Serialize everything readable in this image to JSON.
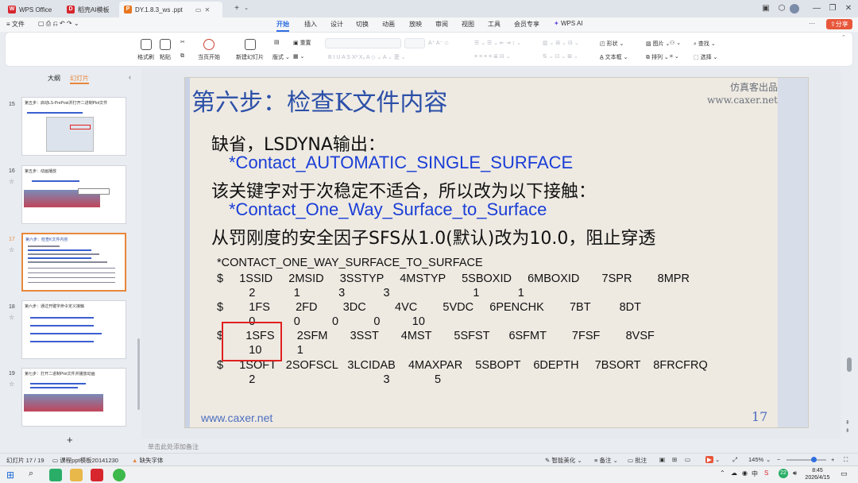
{
  "tabs": [
    {
      "label": "WPS Office",
      "color": "#d7262e"
    },
    {
      "label": "稻壳AI模板",
      "color": "#d7262e"
    },
    {
      "label": "DY.1.8.3_ws .ppt",
      "color": "#e8761f"
    }
  ],
  "menu": {
    "file": "文件",
    "items": [
      "开始",
      "插入",
      "设计",
      "切换",
      "动画",
      "放映",
      "审阅",
      "视图",
      "工具",
      "会员专享"
    ],
    "wps_ai": "WPS AI",
    "share": "分享"
  },
  "ribbon": {
    "format_painter": "格式刷",
    "paste": "粘贴",
    "play_current": "当页开始",
    "new_slide": "新建幻灯片",
    "layout": "版式",
    "reset": "重置",
    "shape": "形状",
    "image": "图片",
    "textbox": "文本框",
    "arrange": "排列",
    "find": "查找",
    "select": "选择"
  },
  "panel": {
    "tab_outline": "大纲",
    "tab_slides": "幻灯片",
    "add": "+"
  },
  "thumbs": [
    {
      "num": "15",
      "title": "第五步：启动LS-PrePost并打开二进制Plot文件"
    },
    {
      "num": "16",
      "title": "第五步：动画播放"
    },
    {
      "num": "17",
      "title": "第六步：检查K文件内容"
    },
    {
      "num": "18",
      "title": "第六步：通过开键字命令定义接触"
    },
    {
      "num": "19",
      "title": "第七步：打开二进制Plot文件并播放动画"
    }
  ],
  "slide": {
    "title": "第六步：检查K文件内容",
    "brand_line1": "仿真客出品",
    "brand_line2": "www.caxer.net",
    "line1": "缺省，LSDYNA输出：",
    "kw1": "*Contact_AUTOMATIC_SINGLE_SURFACE",
    "line2": "该关键字对于次稳定不适合，所以改为以下接触：",
    "kw2": "*Contact_One_Way_Surface_to_Surface",
    "line3": "从罚刚度的安全因子SFS从1.0(默认)改为10.0，阻止穿透",
    "code": [
      "*CONTACT_ONE_WAY_SURFACE_TO_SURFACE",
      "$     1SSID     2MSID     3SSTYP     4MSTYP     5SBOXID     6MBOXID       7SPR        8MPR",
      "          2            1            3            3                          1            1",
      "$        1FS        2FD        3DC         4VC        5VDC     6PENCHK        7BT         8DT",
      "          0            0          0           0          10",
      "$       1SFS       2SFM       3SST       4MST       5SFST      6SFMT        7FSF        8VSF",
      "          10           1",
      "$     1SOFT   2SOFSCL   3LCIDAB    4MAXPAR    5SBOPT    6DEPTH     7BSORT    8FRCFRQ",
      "          2                                        3              5"
    ],
    "footer_url": "www.caxer.net",
    "page": "17"
  },
  "notes_placeholder": "单击此处添加备注",
  "status": {
    "slide_info": "幻灯片 17 / 19",
    "template": "课程ppt模板20141230",
    "missing_font": "缺失字体",
    "smart_beautify": "智能美化",
    "notes": "备注",
    "comment": "批注",
    "zoom": "145%"
  },
  "taskbar": {
    "time": "8:45",
    "date": "2026/4/15",
    "lang": "中",
    "badge": "22"
  }
}
